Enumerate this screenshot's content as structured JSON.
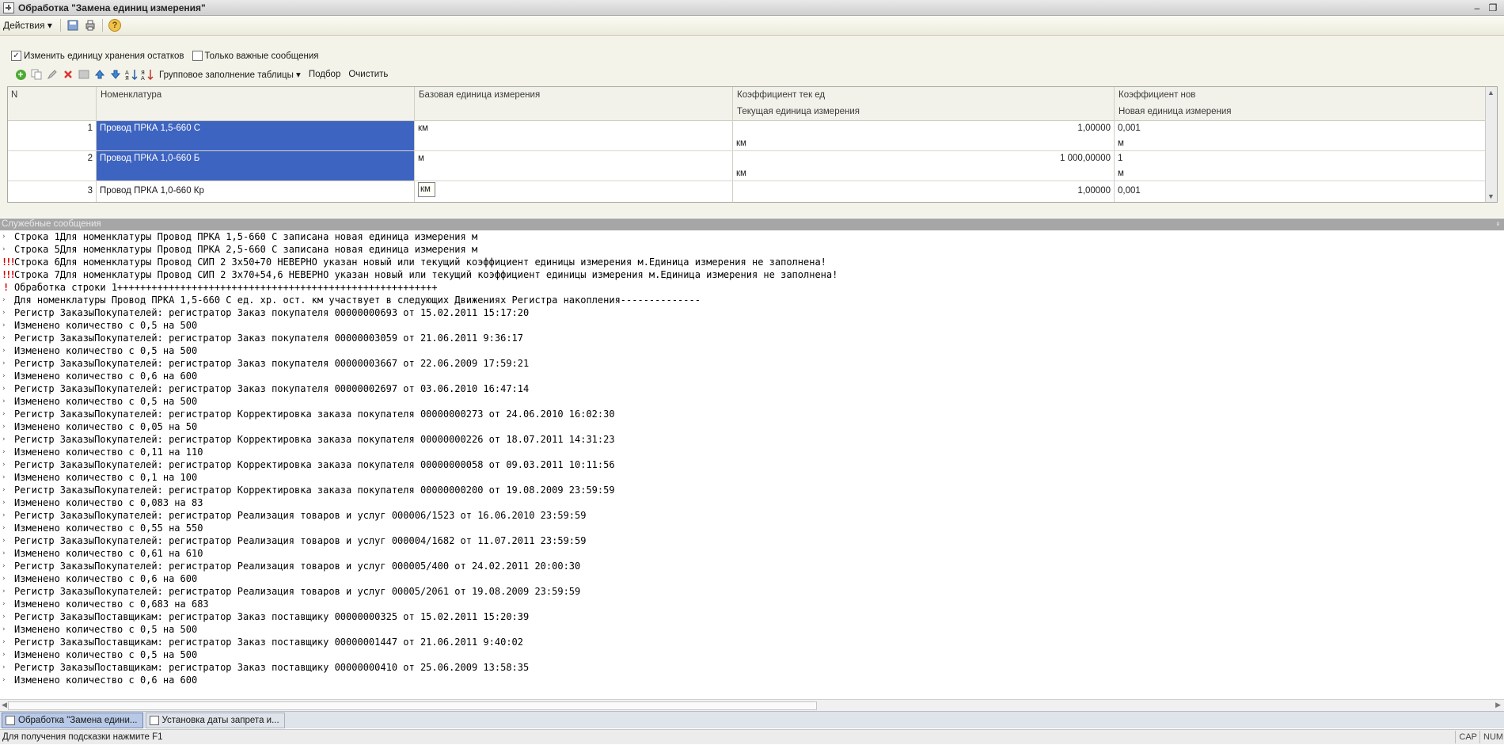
{
  "window": {
    "title": "Обработка  \"Замена единиц измерения\"",
    "minimize": "–",
    "restore": "❐"
  },
  "menubar": {
    "actions_label": "Действия ▾",
    "help_label": "?"
  },
  "options": {
    "change_unit": {
      "label": "Изменить единицу хранения остатков",
      "checked": "✓"
    },
    "important_only": {
      "label": "Только важные сообщения",
      "checked": ""
    }
  },
  "grid_toolbar": {
    "group_fill_label": "Групповое заполнение таблицы ▾",
    "pick_label": "Подбор",
    "clear_label": "Очистить"
  },
  "grid": {
    "headers": {
      "n": "N",
      "nomenclature": "Номенклатура",
      "base_unit": "Базовая единица измерения",
      "coef_current": "Коэффициент тек ед",
      "current_unit": "Текущая единица измерения",
      "coef_new": "Коэффициент нов",
      "new_unit": "Новая единица измерения"
    },
    "rows": [
      {
        "n": "1",
        "nomenclature": "Провод ПРКА 1,5-660 С",
        "base_unit": "км",
        "coef_current": "1,00000",
        "current_unit": "км",
        "coef_new": "0,001",
        "new_unit": "м"
      },
      {
        "n": "2",
        "nomenclature": "Провод ПРКА 1,0-660 Б",
        "base_unit": "м",
        "coef_current": "1 000,00000",
        "current_unit": "км",
        "coef_new": "1",
        "new_unit": "м"
      },
      {
        "n": "3",
        "nomenclature": "Провод ПРКА 1,0-660 Кр",
        "base_unit": "км",
        "coef_current": "1,00000",
        "current_unit": "",
        "coef_new": "0,001",
        "new_unit": ""
      }
    ]
  },
  "messages": {
    "header": "Служебные сообщения",
    "lines": [
      {
        "type": "info",
        "text": "Строка 1Для номенклатуры Провод ПРКА 1,5-660 С записана новая единица измерения м"
      },
      {
        "type": "info",
        "text": "Строка 5Для номенклатуры Провод ПРКА 2,5-660 С записана новая единица измерения м"
      },
      {
        "type": "error",
        "text": "Строка 6Для номенклатуры Провод СИП 2 3х50+70 НЕВЕРНО указан новый или текущий коэффициент единицы измерения м.Единица измерения не заполнена!"
      },
      {
        "type": "error",
        "text": "Строка 7Для номенклатуры Провод СИП 2 3х70+54,6 НЕВЕРНО указан новый или текущий коэффициент единицы измерения м.Единица измерения не заполнена!"
      },
      {
        "type": "warn",
        "text": "Обработка строки 1++++++++++++++++++++++++++++++++++++++++++++++++++++++++"
      },
      {
        "type": "info",
        "text": "Для номенклатуры Провод ПРКА 1,5-660 С ед. хр. ост. км участвует в следующих Движениях Регистра накопления--------------"
      },
      {
        "type": "info",
        "text": "Регистр ЗаказыПокупателей: регистратор Заказ покупателя 00000000693 от 15.02.2011 15:17:20"
      },
      {
        "type": "info",
        "text": "Изменено количество с 0,5 на 500"
      },
      {
        "type": "info",
        "text": "Регистр ЗаказыПокупателей: регистратор Заказ покупателя 00000003059 от 21.06.2011 9:36:17"
      },
      {
        "type": "info",
        "text": "Изменено количество с 0,5 на 500"
      },
      {
        "type": "info",
        "text": "Регистр ЗаказыПокупателей: регистратор Заказ покупателя 00000003667 от 22.06.2009 17:59:21"
      },
      {
        "type": "info",
        "text": "Изменено количество с 0,6 на 600"
      },
      {
        "type": "info",
        "text": "Регистр ЗаказыПокупателей: регистратор Заказ покупателя 00000002697 от 03.06.2010 16:47:14"
      },
      {
        "type": "info",
        "text": "Изменено количество с 0,5 на 500"
      },
      {
        "type": "info",
        "text": "Регистр ЗаказыПокупателей: регистратор Корректировка заказа покупателя 00000000273 от 24.06.2010 16:02:30"
      },
      {
        "type": "info",
        "text": "Изменено количество с 0,05 на 50"
      },
      {
        "type": "info",
        "text": "Регистр ЗаказыПокупателей: регистратор Корректировка заказа покупателя 00000000226 от 18.07.2011 14:31:23"
      },
      {
        "type": "info",
        "text": "Изменено количество с 0,11 на 110"
      },
      {
        "type": "info",
        "text": "Регистр ЗаказыПокупателей: регистратор Корректировка заказа покупателя 00000000058 от 09.03.2011 10:11:56"
      },
      {
        "type": "info",
        "text": "Изменено количество с 0,1 на 100"
      },
      {
        "type": "info",
        "text": "Регистр ЗаказыПокупателей: регистратор Корректировка заказа покупателя 00000000200 от 19.08.2009 23:59:59"
      },
      {
        "type": "info",
        "text": "Изменено количество с 0,083 на 83"
      },
      {
        "type": "info",
        "text": "Регистр ЗаказыПокупателей: регистратор Реализация товаров и услуг 000006/1523 от 16.06.2010 23:59:59"
      },
      {
        "type": "info",
        "text": "Изменено количество с 0,55 на 550"
      },
      {
        "type": "info",
        "text": "Регистр ЗаказыПокупателей: регистратор Реализация товаров и услуг 000004/1682 от 11.07.2011 23:59:59"
      },
      {
        "type": "info",
        "text": "Изменено количество с 0,61 на 610"
      },
      {
        "type": "info",
        "text": "Регистр ЗаказыПокупателей: регистратор Реализация товаров и услуг 000005/400 от 24.02.2011 20:00:30"
      },
      {
        "type": "info",
        "text": "Изменено количество с 0,6 на 600"
      },
      {
        "type": "info",
        "text": "Регистр ЗаказыПокупателей: регистратор Реализация товаров и услуг 00005/2061 от 19.08.2009 23:59:59"
      },
      {
        "type": "info",
        "text": "Изменено количество с 0,683 на 683"
      },
      {
        "type": "info",
        "text": "Регистр ЗаказыПоставщикам: регистратор Заказ поставщику 00000000325 от 15.02.2011 15:20:39"
      },
      {
        "type": "info",
        "text": "Изменено количество с 0,5 на 500"
      },
      {
        "type": "info",
        "text": "Регистр ЗаказыПоставщикам: регистратор Заказ поставщику 00000001447 от 21.06.2011 9:40:02"
      },
      {
        "type": "info",
        "text": "Изменено количество с 0,5 на 500"
      },
      {
        "type": "info",
        "text": "Регистр ЗаказыПоставщикам: регистратор Заказ поставщику 00000000410 от 25.06.2009 13:58:35"
      },
      {
        "type": "info",
        "text": "Изменено количество с 0,6 на 600"
      }
    ]
  },
  "taskbar": {
    "tasks": [
      {
        "label": "Обработка  \"Замена едини...",
        "active": true
      },
      {
        "label": "Установка даты запрета и...",
        "active": false
      }
    ]
  },
  "statusbar": {
    "hint": "Для получения подсказки нажмите F1",
    "cap": "CAP",
    "num": "NUM"
  },
  "colors": {
    "selection": "#3e64c1",
    "error_marker": "#d40000",
    "message_header": "#a6a6a6"
  }
}
